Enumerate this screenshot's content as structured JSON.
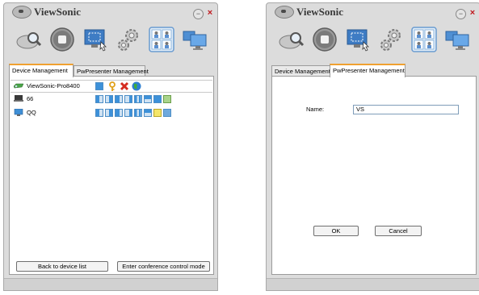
{
  "brand": "ViewSonic",
  "window_controls": {
    "minimize": "−",
    "close": "×"
  },
  "toolbar_icons": [
    "search-remote-icon",
    "stop-icon",
    "screen-select-icon",
    "settings-gear-icon",
    "split-users-icon",
    "display-monitor-icon"
  ],
  "tabs": {
    "device": "Device Management",
    "presenter": "PwPresenter Management"
  },
  "devices": [
    {
      "name": "ViewSonic-Pro8400",
      "icon": "projector-icon"
    },
    {
      "name": "66",
      "icon": "laptop-icon"
    },
    {
      "name": "QQ",
      "icon": "monitor-icon"
    }
  ],
  "footer": {
    "back": "Back to device list",
    "conference": "Enter conference control mode"
  },
  "presenter_form": {
    "name_label": "Name:",
    "name_value": "VS",
    "ok": "OK",
    "cancel": "Cancel"
  }
}
